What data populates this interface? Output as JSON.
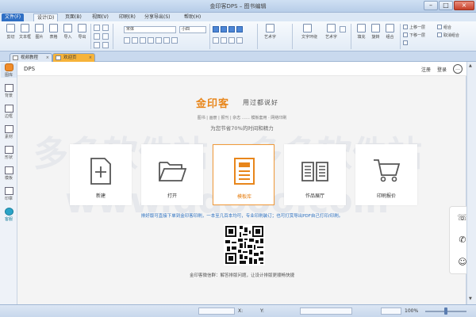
{
  "window": {
    "title": "金印客DPS – 图书编辑"
  },
  "menu": {
    "file": "文件(F)",
    "design": "设计(D)",
    "page": "页面(B)",
    "view": "视图(V)",
    "print": "印刷(R)",
    "share": "分享导出(S)",
    "help": "帮助(H)"
  },
  "ribbon": {
    "tools": [
      "剪切",
      "文本框",
      "图片",
      "表格",
      "导入",
      "导出"
    ],
    "font_name": "宋体",
    "font_size": "小四",
    "art_text": "艺术字",
    "text_arrange": "文字环绕",
    "rotate": "旋转",
    "fill": "填充",
    "group": "组合",
    "arrange_labels": [
      "上移一层",
      "下移一层",
      "组合",
      "取消组合"
    ]
  },
  "tabs": {
    "first": "视频教程",
    "second": "欢迎页",
    "close": "×"
  },
  "leftbar": [
    "图库",
    "背景",
    "边框",
    "素材",
    "形状",
    "模板",
    "印章",
    "客服"
  ],
  "header": {
    "app": "DPS",
    "register": "注册",
    "login": "登录",
    "msg_icon": "chat-bubble-icon"
  },
  "brand": {
    "name": "金印客",
    "slogan": "用过都说好"
  },
  "categories": "图书 | 画册 | 报刊 | 杂志 …… 模板套用 · 网络印刷",
  "save_time": "为您节省70%的时间和精力",
  "cards": [
    {
      "label": "新建",
      "icon": "new-file-icon"
    },
    {
      "label": "打开",
      "icon": "folder-open-icon"
    },
    {
      "label": "模板库",
      "icon": "template-icon"
    },
    {
      "label": "作品展厅",
      "icon": "book-icon"
    },
    {
      "label": "印刷报价",
      "icon": "cart-icon"
    }
  ],
  "hint": "排好版可直接下单到金印客印刷，一本至几百本均可，专业印刷装订；也可打赏导出PDF自己打印/印刷。",
  "qr_caption": "金印客微信群：解答排版问题，让设计排版更顺畅快捷",
  "side_actions": [
    "phone-icon",
    "wechat-icon",
    "service-icon"
  ],
  "status": {
    "x_label": "X:",
    "y_label": "Y:",
    "zoom": "100%"
  },
  "watermarks": [
    "多多软件站",
    "www.ddooo.com",
    "软件站"
  ],
  "colors": {
    "brand_orange": "#e8861b",
    "link_blue": "#2a6fc0",
    "selected_border": "#f19a3a"
  }
}
